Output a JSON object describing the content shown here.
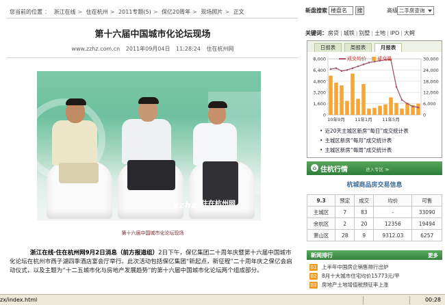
{
  "breadcrumb": {
    "items": [
      "您当前的位置",
      "浙江在线",
      "住在杭州",
      "2011专题(5)",
      "保亿20周年",
      "现场照片",
      "正文"
    ]
  },
  "article": {
    "title": "第十六届中国城市化论坛现场",
    "source_url": "www.zzhz.com.cn",
    "date": "2011年09月04日",
    "time": "11:28:24",
    "source_name": "住在杭州网",
    "photo_caption": "第十六届中国城市化论坛现场",
    "watermark_logo": "zzhz",
    "watermark_name": "住在杭州网",
    "watermark_url": "www.zzhz.com.cn",
    "lead": "浙江在线·住在杭州网9月2日消息（前方报道组）",
    "body": "2日下午，保亿集团二十周年庆暨第十六届中国城市化论坛在杭州市西子湖四季酒店宴会厅举行。此次活动包括保亿集团“新起点，新征程”二十周年庆之保亿会启动仪式，以及主题为“十二五城市化与房地产发展趋势”的第十六届中国城市化论坛两个组成部分。"
  },
  "sidebar": {
    "search_label": "新盘搜索",
    "search_value": "楼盘名",
    "search_button": "搜",
    "advanced_label": "高级",
    "select_value": "二手房查询",
    "keywords_label": "关键词：",
    "keywords": [
      "房贷",
      "城铁",
      "别墅",
      "土地",
      "IPO",
      "大鳄"
    ],
    "tabs": [
      "日报表",
      "周报表",
      "月报表"
    ],
    "links": [
      "近20天主城区新房“每日”成交统计表",
      "主城区新房“每月”成交统计表",
      "主城区新房“每周”成交统计表"
    ],
    "market_bar_title": "住杭行情",
    "market_bar_more": "进入专区 ≫",
    "market_title": "杭城商品房交易信息",
    "market_table": {
      "headers": [
        "9.3",
        "预定",
        "成交",
        "均价",
        "可售"
      ],
      "rows": [
        [
          "主城区",
          "7",
          "83",
          "-",
          "33090"
        ],
        [
          "余杭区",
          "2",
          "20",
          "12356",
          "19494"
        ],
        [
          "萧山区",
          "28",
          "9",
          "9312.03",
          "6257"
        ]
      ]
    },
    "news_title": "新闻排行",
    "news_more": "更多",
    "news": [
      {
        "num": "01",
        "text": "上半年中国房企销售排行出炉"
      },
      {
        "num": "02",
        "text": "8月十大城市住宅均价15773元/平"
      },
      {
        "num": "03",
        "text": "房地产土地增值税预征率上涨"
      }
    ]
  },
  "chart_data": {
    "type": "bar",
    "legend": [
      "成交均价",
      "成交量"
    ],
    "x_tick_labels": [
      "10年9月",
      "11年1月",
      "11年5月"
    ],
    "y_left": {
      "ylim": [
        0,
        8000
      ],
      "ticks": [
        "8,000",
        "6,400",
        "4,800",
        "3,200",
        "1,600",
        "0"
      ]
    },
    "y_right": {
      "ylim": [
        0,
        30000
      ],
      "ticks": [
        "30,000",
        "24,000",
        "18,000",
        "12,000",
        "6,000",
        "0"
      ]
    },
    "series": [
      {
        "name": "成交量",
        "values": [
          5600,
          4600,
          4200,
          2000,
          5900,
          2300,
          4400,
          900,
          1000,
          1300,
          1500,
          2500,
          1700,
          900,
          1700,
          1400,
          1600
        ]
      },
      {
        "name": "成交均价",
        "values": [
          24500,
          25000,
          23500,
          24000,
          25000,
          26000,
          27000,
          28000,
          28500,
          29000,
          29500,
          29500,
          15000,
          8000,
          6000,
          4500,
          4000
        ]
      }
    ],
    "colors": {
      "bars": "#f4a838",
      "line": "#a15570",
      "grid": "#d9d9d9"
    },
    "grid": true,
    "legend_placement": "top-left"
  },
  "statusbar": {
    "url": "zx/index.html",
    "time": "00:28"
  }
}
